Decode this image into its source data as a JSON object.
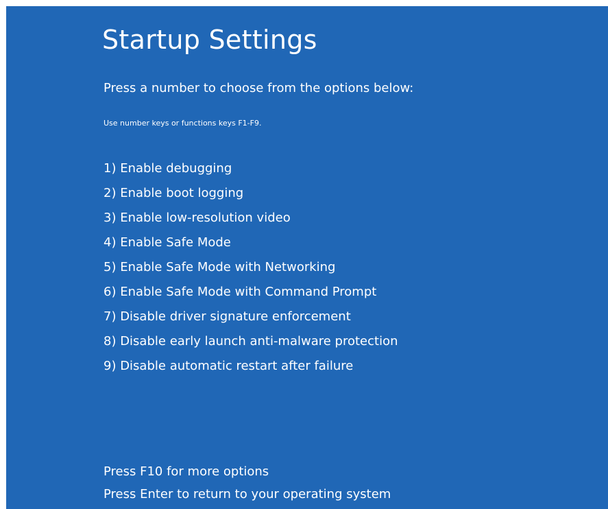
{
  "screen": {
    "title": "Startup Settings",
    "subtitle": "Press a number to choose from the options below:",
    "hint": "Use number keys or functions keys F1-F9.",
    "background_color": "#2067b6",
    "text_color": "#ffffff"
  },
  "options": [
    {
      "label": "1) Enable debugging"
    },
    {
      "label": "2) Enable boot logging"
    },
    {
      "label": "3) Enable low-resolution video"
    },
    {
      "label": "4) Enable Safe Mode"
    },
    {
      "label": "5) Enable Safe Mode with Networking"
    },
    {
      "label": "6) Enable Safe Mode with Command Prompt"
    },
    {
      "label": "7) Disable driver signature enforcement"
    },
    {
      "label": "8) Disable early launch anti-malware protection"
    },
    {
      "label": "9) Disable automatic restart after failure"
    }
  ],
  "footer": {
    "more_options": "Press F10 for more options",
    "return_os": "Press Enter to return to your operating system"
  }
}
